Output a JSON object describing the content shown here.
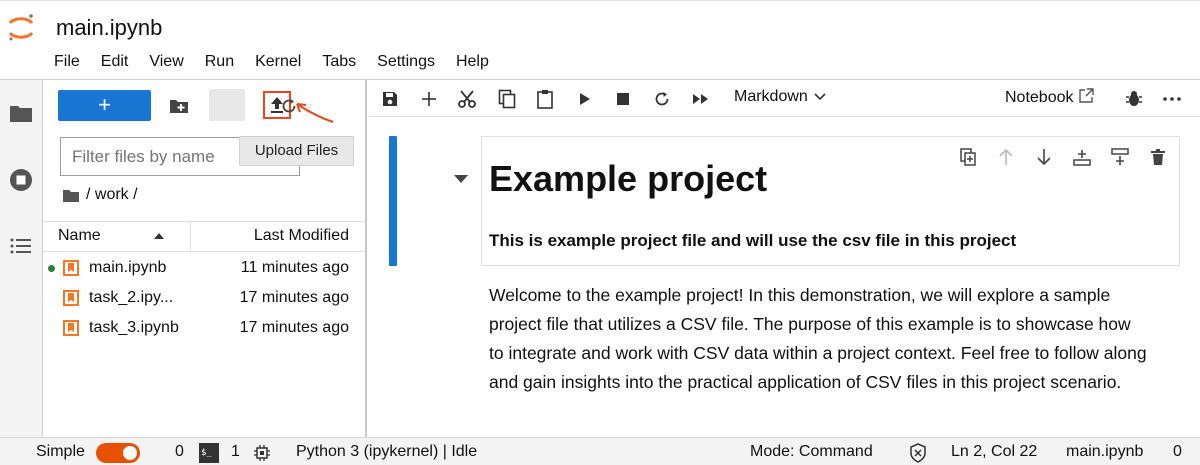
{
  "window": {
    "title": "main.ipynb"
  },
  "menu": [
    "File",
    "Edit",
    "View",
    "Run",
    "Kernel",
    "Tabs",
    "Settings",
    "Help"
  ],
  "file_browser": {
    "new_label": "+",
    "filter_placeholder": "Filter files by name",
    "tooltip": "Upload Files",
    "breadcrumb": "/ work /",
    "columns": {
      "name": "Name",
      "modified": "Last Modified"
    },
    "files": [
      {
        "name": "main.ipynb",
        "modified": "11 minutes ago",
        "running": true
      },
      {
        "name": "task_2.ipy...",
        "modified": "17 minutes ago",
        "running": false
      },
      {
        "name": "task_3.ipynb",
        "modified": "17 minutes ago",
        "running": false
      }
    ]
  },
  "notebook": {
    "cell_type": "Markdown",
    "kernel_label": "Notebook",
    "heading": "Example project",
    "subheading": "This is example project file and will use the csv file in this project",
    "paragraph": "Welcome to the example project! In this demonstration, we will explore a sample project file that utilizes a CSV file. The purpose of this example is to showcase how to integrate and work with CSV data within a project context. Feel free to follow along and gain insights into the practical application of CSV files in this project scenario."
  },
  "status": {
    "mode_label": "Simple",
    "kernels_count": "0",
    "terminals_count": "1",
    "kernel": "Python 3 (ipykernel) | Idle",
    "mode": "Mode: Command",
    "position": "Ln 2, Col 22",
    "file": "main.ipynb",
    "notifications": "0"
  },
  "colors": {
    "accent": "#1976d2",
    "highlight": "#e8481c",
    "toggle": "#e65100",
    "notebook_icon": "#f37726"
  }
}
